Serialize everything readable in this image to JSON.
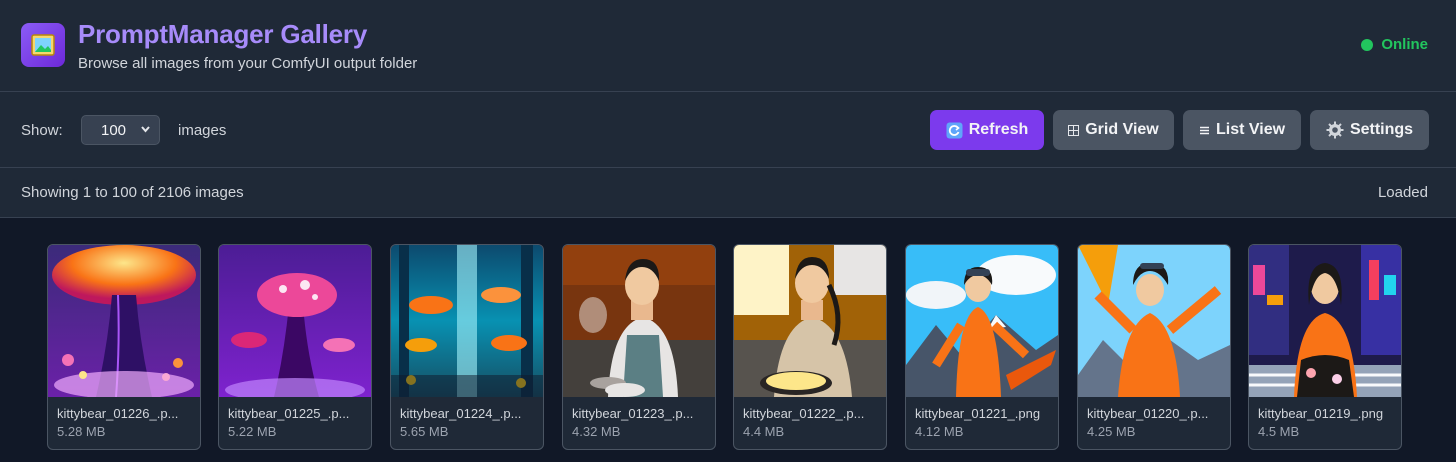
{
  "header": {
    "title": "PromptManager Gallery",
    "subtitle": "Browse all images from your ComfyUI output folder",
    "status": "Online"
  },
  "toolbar": {
    "show_label": "Show:",
    "page_size": "100",
    "images_label": "images",
    "refresh": "Refresh",
    "grid_view": "Grid View",
    "list_view": "List View",
    "settings": "Settings"
  },
  "info": {
    "showing": "Showing 1 to 100 of 2106 images",
    "state": "Loaded"
  },
  "images": [
    {
      "name": "kittybear_01226_.p...",
      "size": "5.28 MB"
    },
    {
      "name": "kittybear_01225_.p...",
      "size": "5.22 MB"
    },
    {
      "name": "kittybear_01224_.p...",
      "size": "5.65 MB"
    },
    {
      "name": "kittybear_01223_.p...",
      "size": "4.32 MB"
    },
    {
      "name": "kittybear_01222_.p...",
      "size": "4.4 MB"
    },
    {
      "name": "kittybear_01221_.png",
      "size": "4.12 MB"
    },
    {
      "name": "kittybear_01220_.p...",
      "size": "4.25 MB"
    },
    {
      "name": "kittybear_01219_.png",
      "size": "4.5 MB"
    }
  ]
}
